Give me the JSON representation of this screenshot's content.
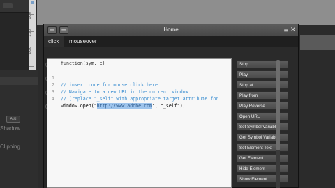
{
  "dialog": {
    "title": "Home",
    "add_label": "+",
    "remove_label": "−",
    "menu_icon": "≡",
    "close_icon": "×"
  },
  "tabs": [
    {
      "label": "click",
      "active": true
    },
    {
      "label": "mouseover",
      "active": false
    }
  ],
  "code": {
    "signature": "function(sym, e)",
    "lines": [
      {
        "num": "1",
        "text": "// insert code for mouse click here"
      },
      {
        "num": "2",
        "text": "// Navigate to a new URL in the current window"
      },
      {
        "num": "3",
        "text": "// (replace \"_self\" with appropriate target attribute for"
      },
      {
        "num": "4",
        "before": "window.open(\"",
        "selected": "http://www.adobe.com",
        "after": "\", \"_self\");"
      }
    ]
  },
  "actions": [
    "Stop",
    "Play",
    "Stop at",
    "Play from",
    "Play Reverse",
    "Open URL",
    "Set Symbol Variable",
    "Get Symbol Variable",
    "Set Element Text",
    "Get Element",
    "Hide Element",
    "Show Element"
  ],
  "background": {
    "ruler_labels": [
      "100",
      "150",
      "200"
    ],
    "left_labels": [
      "Shadow",
      "Clipping"
    ],
    "add_label": "Add"
  },
  "colors": {
    "comment": "#3d8fd1",
    "selection": "#9ec4ec",
    "button": "#555555"
  }
}
